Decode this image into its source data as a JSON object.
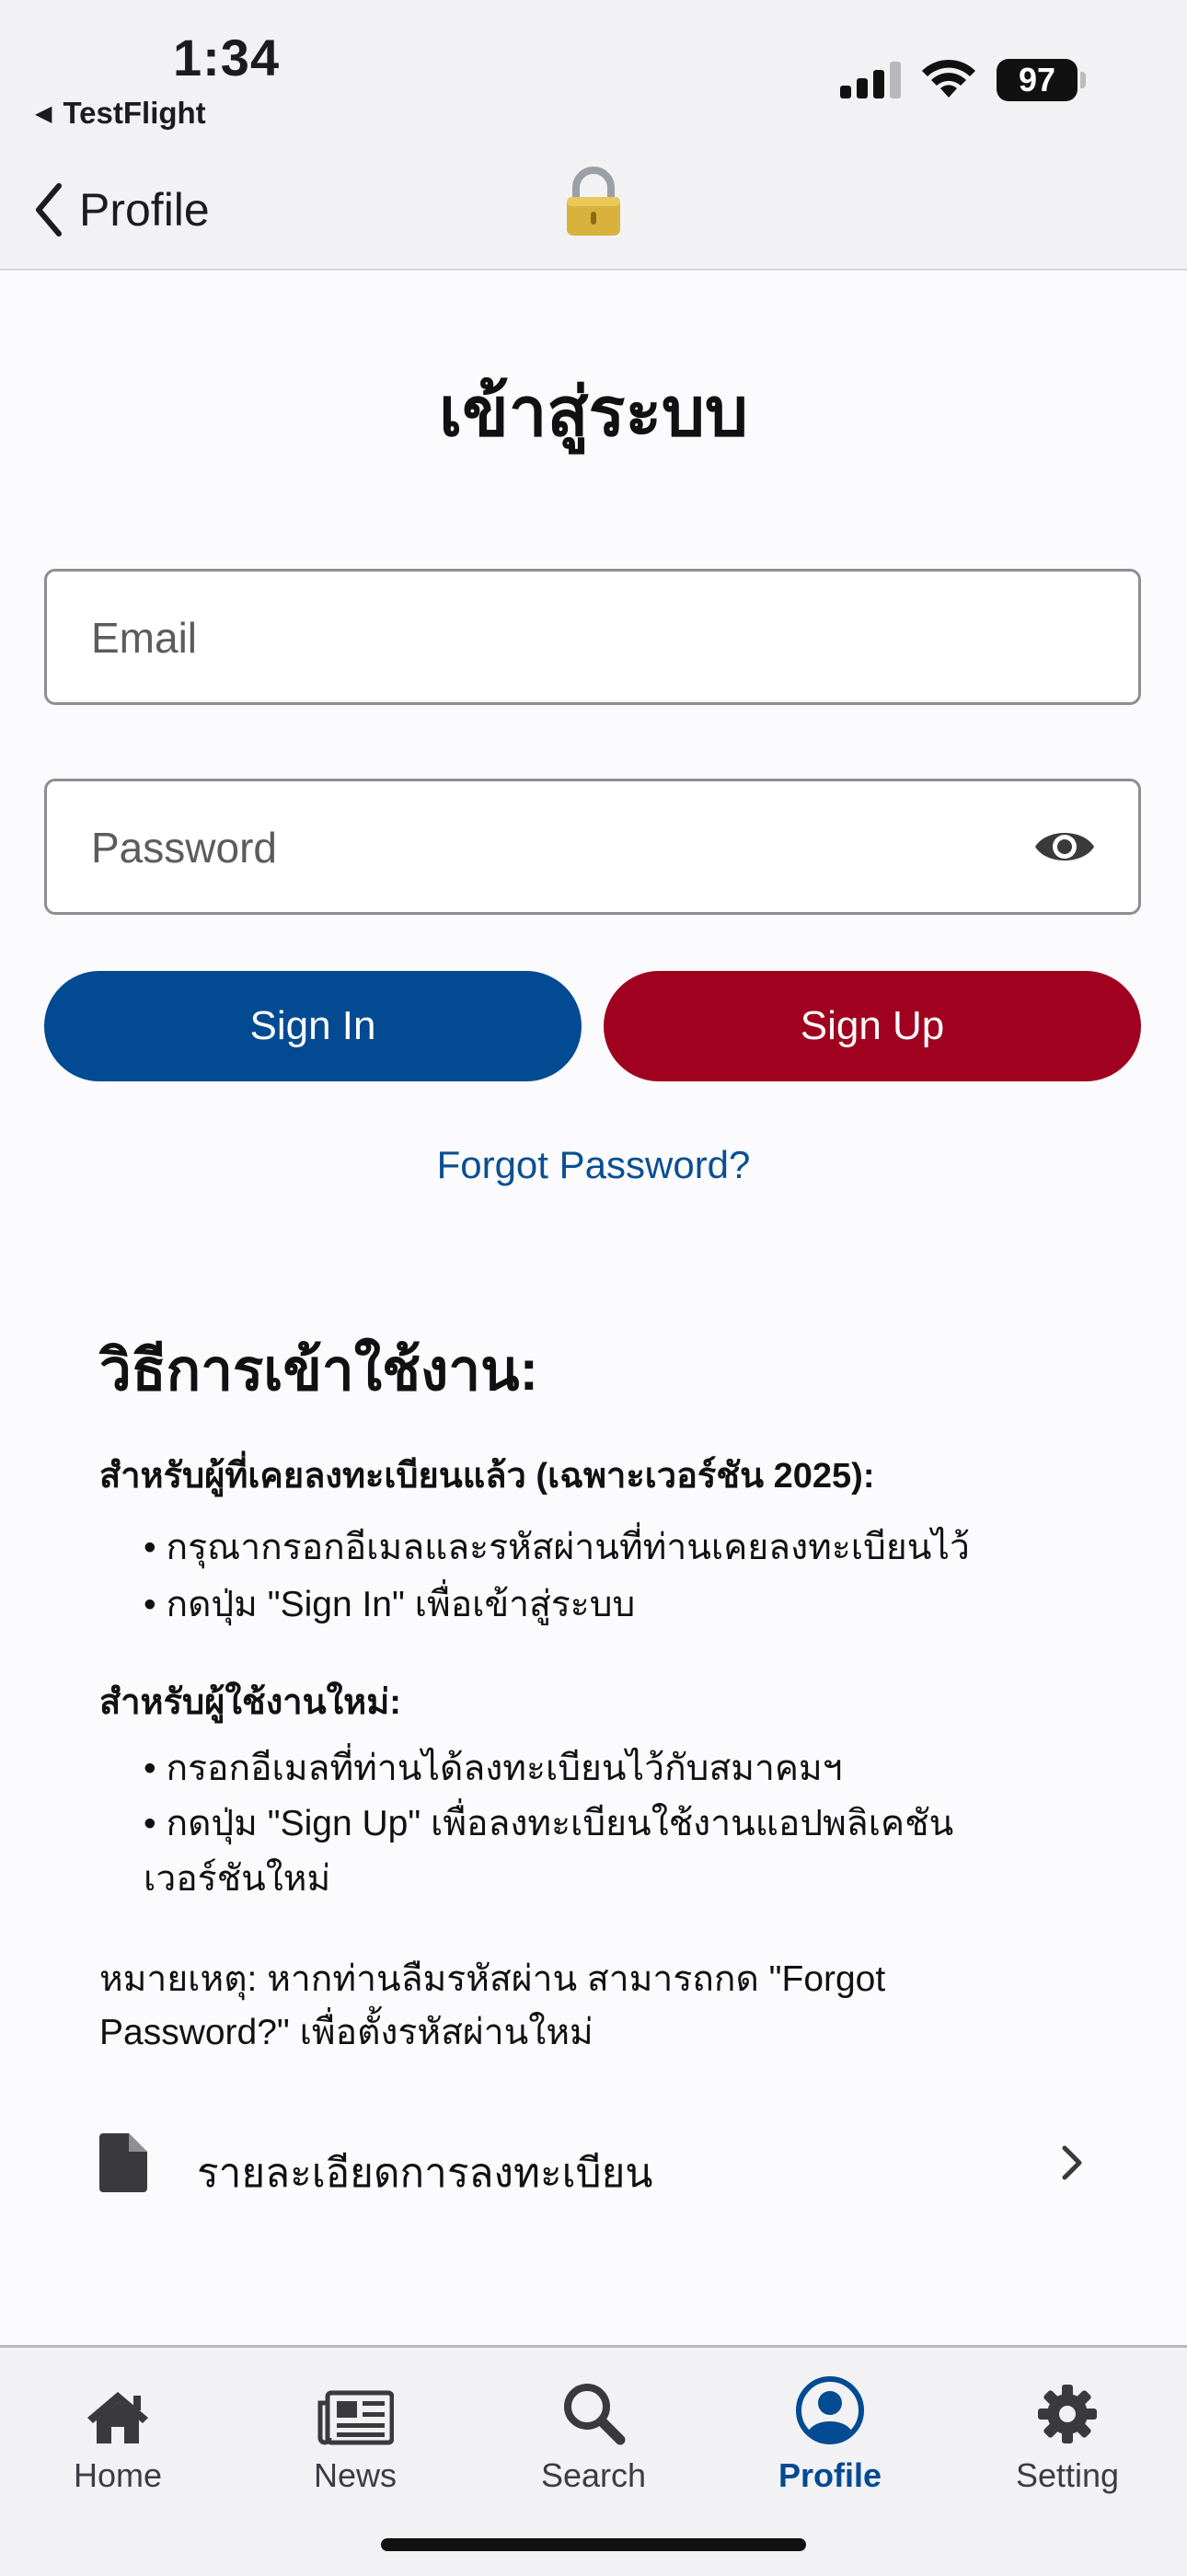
{
  "status_bar": {
    "time": "1:34",
    "back_app": "TestFlight",
    "battery": "97"
  },
  "nav": {
    "back_label": "Profile",
    "center_icon": "lock-icon"
  },
  "login": {
    "title": "เข้าสู่ระบบ",
    "email_placeholder": "Email",
    "password_placeholder": "Password",
    "sign_in": "Sign In",
    "sign_up": "Sign Up",
    "forgot": "Forgot Password?"
  },
  "instructions": {
    "heading": "วิธีการเข้าใช้งาน:",
    "existing_heading": "สำหรับผู้ที่เคยลงทะเบียนแล้ว (เฉพาะเวอร์ชัน 2025):",
    "existing_items": [
      "• กรุณากรอกอีเมลและรหัสผ่านที่ท่านเคยลงทะเบียนไว้",
      "• กดปุ่ม \"Sign In\" เพื่อเข้าสู่ระบบ"
    ],
    "new_heading": "สำหรับผู้ใช้งานใหม่:",
    "new_items": [
      "• กรอกอีเมลที่ท่านได้ลงทะเบียนไว้กับสมาคมฯ",
      "• กดปุ่ม \"Sign Up\" เพื่อลงทะเบียนใช้งานแอปพลิเคชัน",
      "เวอร์ชันใหม่"
    ],
    "note": "หมายเหตุ: หากท่านลืมรหัสผ่าน สามารถกด \"Forgot Password?\" เพื่อตั้งรหัสผ่านใหม่"
  },
  "registration_link": {
    "label": "รายละเอียดการลงทะเบียน"
  },
  "tabs": [
    {
      "label": "Home",
      "icon": "home-icon"
    },
    {
      "label": "News",
      "icon": "newspaper-icon"
    },
    {
      "label": "Search",
      "icon": "search-icon"
    },
    {
      "label": "Profile",
      "icon": "profile-icon",
      "active": true
    },
    {
      "label": "Setting",
      "icon": "gear-icon"
    }
  ],
  "colors": {
    "primary": "#024a92",
    "danger": "#a0011f"
  }
}
